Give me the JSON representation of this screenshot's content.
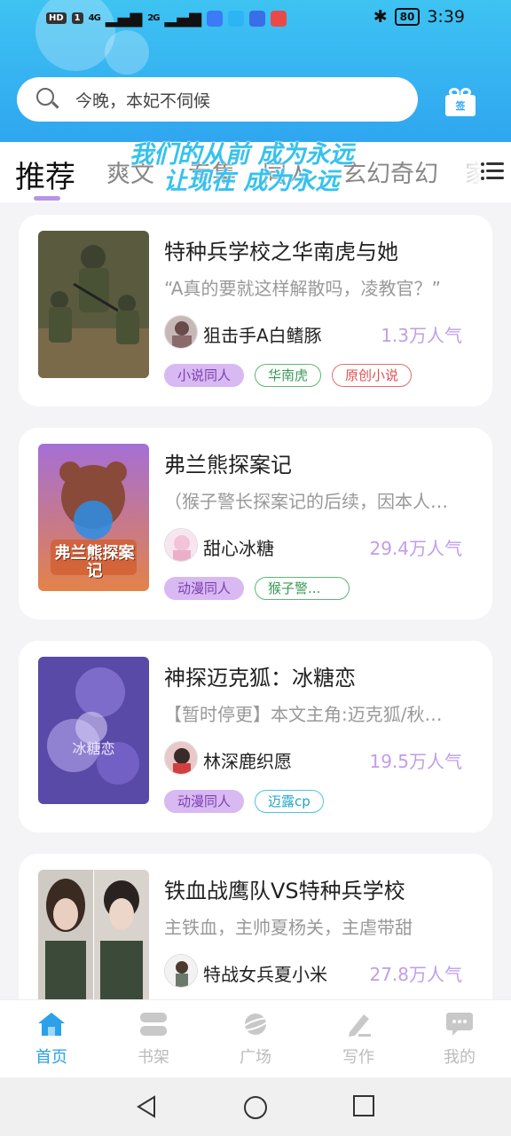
{
  "status_bar": {
    "left_indicators": [
      "HD",
      "1",
      "4G",
      "2G"
    ],
    "battery": "80",
    "time": "3:39"
  },
  "search": {
    "placeholder": "今晚，本妃不伺候"
  },
  "checkin": {
    "label": "签"
  },
  "tabs": [
    {
      "label": "推荐",
      "active": true
    },
    {
      "label": "爽文"
    },
    {
      "label": "专集"
    },
    {
      "label": "同人"
    },
    {
      "label": "玄幻奇幻"
    },
    {
      "label": "家"
    }
  ],
  "watermark": {
    "line1": "我们的从前 成为永远",
    "line2": "让现在 成为永远"
  },
  "books": [
    {
      "title": "特种兵学校之华南虎与她",
      "desc": "“A真的要就这样解散吗，凌教官？”",
      "author": "狙击手A白鳍豚",
      "popularity": "1.3万人气",
      "tags": [
        {
          "label": "小说同人",
          "style": "purple"
        },
        {
          "label": "华南虎",
          "style": "green"
        },
        {
          "label": "原创小说",
          "style": "red"
        }
      ]
    },
    {
      "title": "弗兰熊探案记",
      "desc": "（猴子警长探案记的后续，因本人…",
      "author": "甜心冰糖",
      "popularity": "29.4万人气",
      "cover_text": "弗兰熊探案记",
      "tags": [
        {
          "label": "动漫同人",
          "style": "purple"
        },
        {
          "label": "猴子警...",
          "style": "green"
        }
      ]
    },
    {
      "title": "神探迈克狐：冰糖恋",
      "desc": "【暂时停更】本文主角:迈克狐/秋…",
      "author": "林深鹿织愿",
      "popularity": "19.5万人气",
      "cover_text": "冰糖恋",
      "tags": [
        {
          "label": "动漫同人",
          "style": "purple"
        },
        {
          "label": "迈露cp",
          "style": "cyan"
        }
      ]
    },
    {
      "title": "铁血战鹰队VS特种兵学校",
      "desc": "主铁血，主帅夏杨关，主虐带甜",
      "author": "特战女兵夏小米",
      "popularity": "27.8万人气",
      "tags": []
    }
  ],
  "bottom_nav": [
    {
      "label": "首页",
      "icon": "home-icon",
      "active": true
    },
    {
      "label": "书架",
      "icon": "bookshelf-icon"
    },
    {
      "label": "广场",
      "icon": "planet-icon"
    },
    {
      "label": "写作",
      "icon": "pen-icon"
    },
    {
      "label": "我的",
      "icon": "chat-bubble-icon"
    }
  ],
  "colors": {
    "header": "#3ec3f2",
    "accent": "#2aa1e9",
    "popularity": "#c09ee8",
    "tag_purple": "#d9b9f2"
  }
}
